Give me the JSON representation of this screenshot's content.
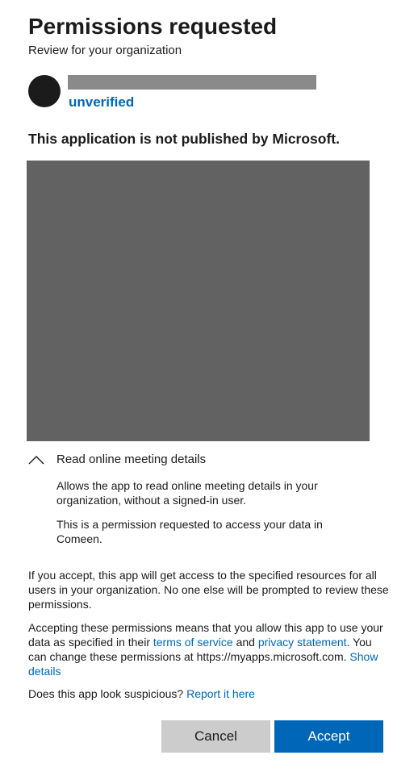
{
  "header": {
    "title": "Permissions requested",
    "subtitle": "Review for your organization"
  },
  "app": {
    "publisher_status": "unverified"
  },
  "warning": "This application is not published by Microsoft.",
  "permission": {
    "title": "Read online meeting details",
    "description": "Allows the app to read online meeting details in your organization, without a signed-in user.",
    "note": "This is a permission requested to access your data in Comeen.",
    "expanded": true,
    "chevron_icon": "chevron-up-icon"
  },
  "consent": {
    "text": "If you accept, this app will get access to the specified resources for all users in your organization. No one else will be prompted to review these permissions."
  },
  "accept_info": {
    "prefix": "Accepting these permissions means that you allow this app to use your data as specified in their ",
    "terms_link": "terms of service",
    "and": " and ",
    "privacy_link": "privacy statement",
    "middle": ". You can change these permissions at https://myapps.microsoft.com. ",
    "details_link": "Show details"
  },
  "suspicious": {
    "prefix": "Does this app look suspicious? ",
    "report_link": "Report it here"
  },
  "buttons": {
    "cancel": "Cancel",
    "accept": "Accept"
  },
  "colors": {
    "link": "#0067b8",
    "accept_bg": "#0067b8",
    "cancel_bg": "#cccccc",
    "redacted": "#626262",
    "redacted_name": "#8a8a8a",
    "logo": "#1b1b1b"
  }
}
